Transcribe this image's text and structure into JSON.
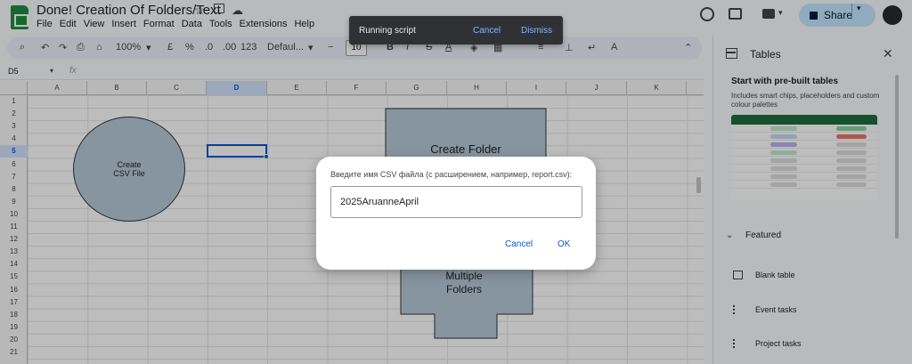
{
  "header": {
    "title": "Done! Creation Of Folders/Text",
    "menus": [
      "File",
      "Edit",
      "View",
      "Insert",
      "Format",
      "Data",
      "Tools",
      "Extensions",
      "Help"
    ],
    "share_label": "Share"
  },
  "toolbar": {
    "zoom": "100%",
    "currency": "£",
    "percent": "%",
    "decrease_decimal": ".0",
    "increase_decimal": ".00",
    "number_format": "123",
    "font": "Defaul...",
    "font_size": "10",
    "bold": "B",
    "italic": "I",
    "strikethrough": "S",
    "text_color": "A"
  },
  "formula_bar": {
    "cell_ref": "D5",
    "fx": "fx"
  },
  "grid": {
    "columns": [
      "A",
      "B",
      "C",
      "D",
      "E",
      "F",
      "G",
      "H",
      "I",
      "J",
      "K"
    ],
    "selected_column": "D",
    "rows": [
      "1",
      "2",
      "3",
      "4",
      "5",
      "6",
      "7",
      "8",
      "9",
      "10",
      "11",
      "12",
      "13",
      "14",
      "15",
      "16",
      "17",
      "18",
      "19",
      "20",
      "21"
    ],
    "selected_row": "5"
  },
  "shapes": {
    "circle_text": "Create\nCSV File",
    "folder_top_text": "Create Folder",
    "folder_bottom_text": "Multiple\nFolders"
  },
  "side_panel": {
    "title": "Tables",
    "prebuilt_heading": "Start with pre-built tables",
    "prebuilt_desc": "Includes smart chips, placeholders and custom colour palettes",
    "featured_label": "Featured",
    "options": [
      "Blank table",
      "Event tasks",
      "Project tasks"
    ]
  },
  "toast": {
    "message": "Running script",
    "cancel": "Cancel",
    "dismiss": "Dismiss"
  },
  "dialog": {
    "prompt": "Введите имя CSV файла (с расширением, например, report.csv):",
    "input_value": "2025AruanneApril",
    "cancel": "Cancel",
    "ok": "OK"
  },
  "colors": {
    "selection": "#0b57d0",
    "shape_fill": "#b7c9d9",
    "share_bg": "#c2e7ff",
    "overlay": "rgba(0,0,0,0.26)"
  }
}
